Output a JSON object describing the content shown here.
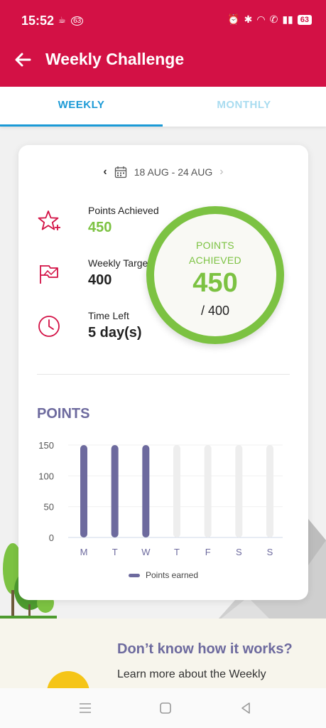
{
  "status_bar": {
    "time": "15:52",
    "notif_badge": "63",
    "battery": "63",
    "icons": [
      "alarm-icon",
      "bluetooth-icon",
      "wifi-icon",
      "call-icon",
      "signal-icon",
      "battery-icon"
    ]
  },
  "app_bar": {
    "title": "Weekly Challenge",
    "back_icon": "arrow-left-icon"
  },
  "tabs": [
    {
      "label": "WEEKLY",
      "active": true
    },
    {
      "label": "MONTHLY",
      "active": false
    }
  ],
  "date_range": {
    "label": "18 AUG - 24 AUG"
  },
  "stats": {
    "points_achieved": {
      "label": "Points Achieved",
      "value": "450"
    },
    "weekly_target": {
      "label": "Weekly Target",
      "value": "400"
    },
    "time_left": {
      "label": "Time Left",
      "value": "5 day(s)"
    }
  },
  "ring": {
    "label_line1": "POINTS",
    "label_line2": "ACHIEVED",
    "value": "450",
    "target": "/ 400"
  },
  "points_section": {
    "title": "POINTS"
  },
  "chart_data": {
    "type": "bar",
    "categories": [
      "M",
      "T",
      "W",
      "T",
      "F",
      "S",
      "S"
    ],
    "series": [
      {
        "name": "Points earned",
        "values": [
          150,
          150,
          150,
          0,
          0,
          0,
          0
        ]
      }
    ],
    "ylim": [
      0,
      150
    ],
    "yticks": [
      0,
      50,
      100,
      150
    ],
    "legend_position": "bottom",
    "grid": true
  },
  "legend": {
    "label": "Points earned"
  },
  "info": {
    "headline": "Don’t know how it works?",
    "subtext": "Learn more about the Weekly"
  },
  "colors": {
    "brand": "#d31145",
    "tab_active": "#1b9ad6",
    "green": "#7cc242",
    "purple": "#6d6a9e",
    "bar_inactive": "#eeeeee"
  }
}
